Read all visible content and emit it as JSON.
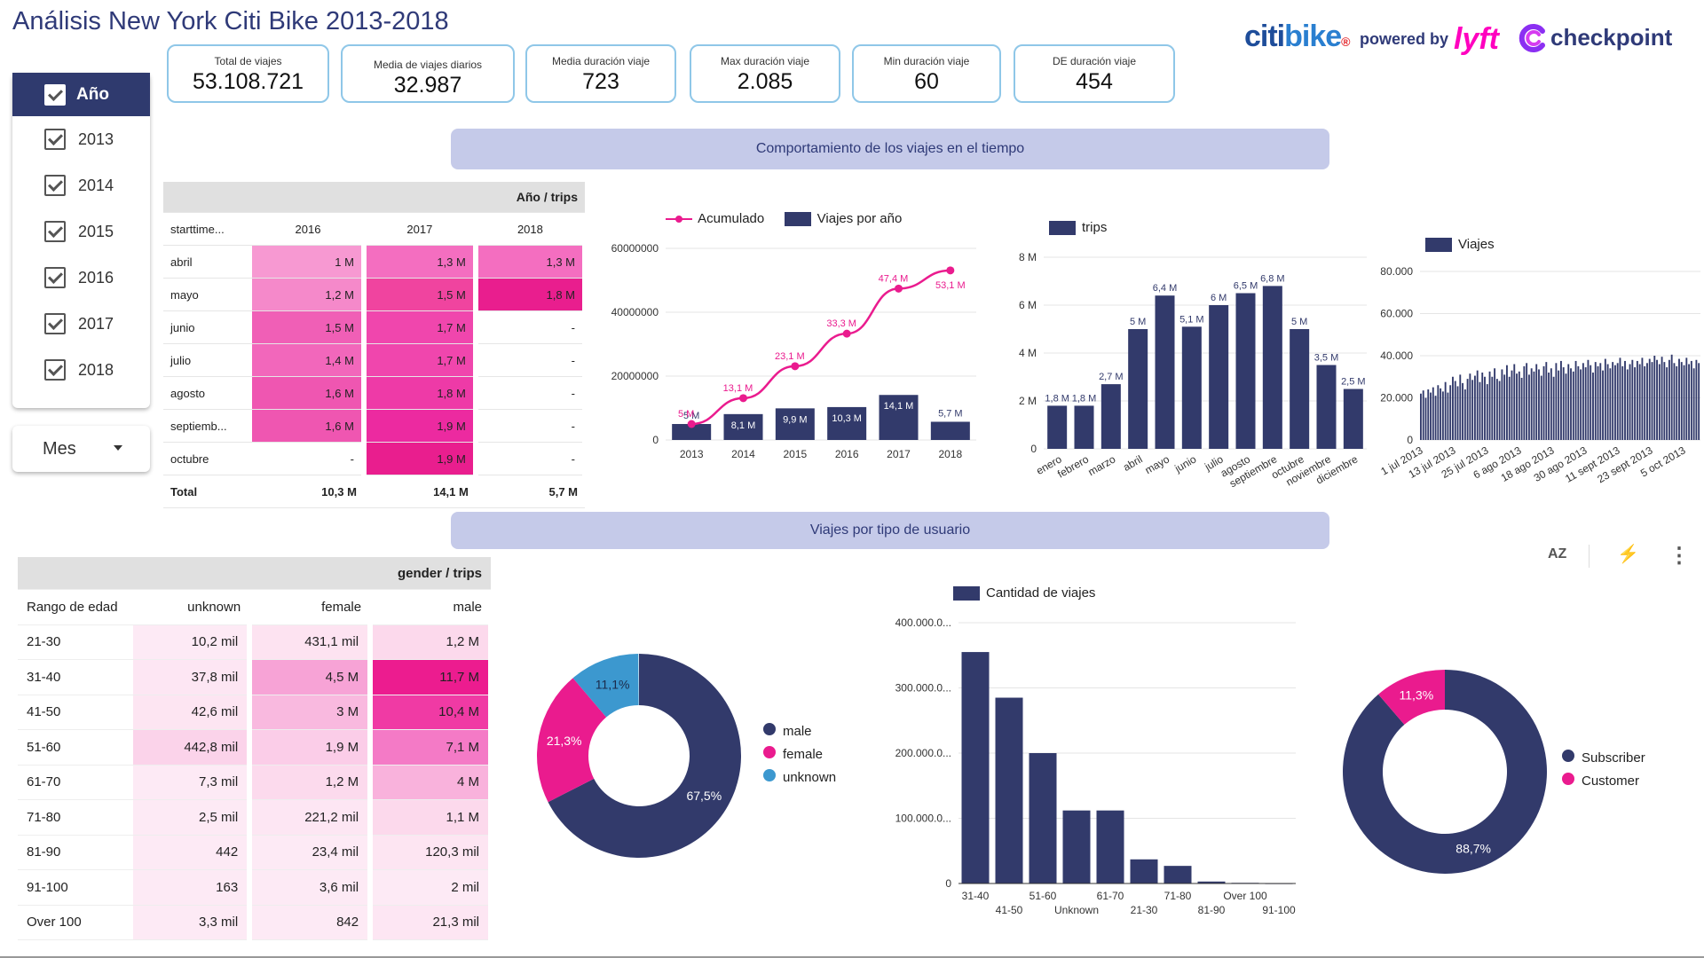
{
  "title": "Análisis New York Citi Bike 2013-2018",
  "logos": {
    "citi": "citi",
    "bike": "bike",
    "r": "®",
    "powered": "powered by",
    "lyft": "lyft",
    "checkpoint": "checkpoint"
  },
  "kpis": [
    {
      "label": "Total de viajes",
      "value": "53.108.721"
    },
    {
      "label": "Media de viajes diarios",
      "value": "32.987"
    },
    {
      "label": "Media duración viaje",
      "value": "723"
    },
    {
      "label": "Max duración viaje",
      "value": "2.085"
    },
    {
      "label": "Min duración viaje",
      "value": "60"
    },
    {
      "label": "DE duración viaje",
      "value": "454"
    }
  ],
  "filter": {
    "header": "Año",
    "items": [
      "2013",
      "2014",
      "2015",
      "2016",
      "2017",
      "2018"
    ],
    "mes": "Mes"
  },
  "banners": {
    "tiempo": "Comportamiento de los viajes en el tiempo",
    "usuario": "Viajes por tipo de usuario"
  },
  "table_year": {
    "group": "Año / trips",
    "cols": [
      "starttime...",
      "2016",
      "2017",
      "2018"
    ],
    "rows": [
      {
        "m": "abril",
        "v": [
          "1 M",
          "1,3 M",
          "1,3 M"
        ]
      },
      {
        "m": "mayo",
        "v": [
          "1,2 M",
          "1,5 M",
          "1,8 M"
        ]
      },
      {
        "m": "junio",
        "v": [
          "1,5 M",
          "1,7 M",
          "-"
        ]
      },
      {
        "m": "julio",
        "v": [
          "1,4 M",
          "1,7 M",
          "-"
        ]
      },
      {
        "m": "agosto",
        "v": [
          "1,6 M",
          "1,8 M",
          "-"
        ]
      },
      {
        "m": "septiemb...",
        "v": [
          "1,6 M",
          "1,9 M",
          "-"
        ]
      },
      {
        "m": "octubre",
        "v": [
          "-",
          "1,9 M",
          "-"
        ]
      }
    ],
    "total": {
      "label": "Total",
      "v": [
        "10,3 M",
        "14,1 M",
        "5,7 M"
      ]
    },
    "colors": [
      [
        "#f799d2",
        "#f46ec0",
        "#f46ec0"
      ],
      [
        "#f589ca",
        "#f0449f",
        "#e91e8e"
      ],
      [
        "#f05fb6",
        "#f046ad",
        "#ffffff"
      ],
      [
        "#f267bb",
        "#f046ad",
        "#ffffff"
      ],
      [
        "#ef56b1",
        "#ee3aa7",
        "#ffffff"
      ],
      [
        "#ef56b1",
        "#ec2aa0",
        "#ffffff"
      ],
      [
        "#ffffff",
        "#e91e8e",
        "#ffffff"
      ]
    ]
  },
  "chart_combo": {
    "type": "bar",
    "legend": [
      "Acumulado",
      "Viajes por año"
    ],
    "categories": [
      "2013",
      "2014",
      "2015",
      "2016",
      "2017",
      "2018"
    ],
    "bars": [
      5.0,
      8.1,
      9.9,
      10.3,
      14.1,
      5.7
    ],
    "bar_labels": [
      "5 M",
      "8,1 M",
      "9,9 M",
      "10,3 M",
      "14,1 M",
      "5,7 M"
    ],
    "line": [
      5.0,
      13.1,
      23.1,
      33.3,
      47.4,
      53.1
    ],
    "line_labels": [
      "5 M",
      "13,1 M",
      "23,1 M",
      "33,3 M",
      "47,4 M",
      "53,1 M"
    ],
    "yticks": [
      "0",
      "20000000",
      "40000000",
      "60000000"
    ],
    "ylim": [
      0,
      60
    ]
  },
  "chart_month": {
    "type": "bar",
    "legend": "trips",
    "categories": [
      "enero",
      "febrero",
      "marzo",
      "abril",
      "mayo",
      "junio",
      "julio",
      "agosto",
      "septiembre",
      "octubre",
      "noviembre",
      "diciembre"
    ],
    "values": [
      1.8,
      1.8,
      2.7,
      5.0,
      6.4,
      5.1,
      6.0,
      6.5,
      6.8,
      5.0,
      3.5,
      2.5
    ],
    "labels": [
      "1,8 M",
      "1,8 M",
      "2,7 M",
      "5 M",
      "6,4 M",
      "5,1 M",
      "6 M",
      "6,5 M",
      "6,8 M",
      "5 M",
      "3,5 M",
      "2,5 M"
    ],
    "yticks": [
      "0",
      "2 M",
      "4 M",
      "6 M",
      "8 M"
    ],
    "ylim": [
      0,
      8
    ]
  },
  "chart_daily": {
    "type": "bar",
    "legend": "Viajes",
    "xticks": [
      "1 jul 2013",
      "13 jul 2013",
      "25 jul 2013",
      "6 ago 2013",
      "18 ago 2013",
      "30 ago 2013",
      "11 sept 2013",
      "23 sept 2013",
      "5 oct 2013"
    ],
    "yticks": [
      "0",
      "20.000",
      "40.000",
      "60.000",
      "80.000"
    ],
    "ylim": [
      0,
      80000
    ],
    "values": [
      22000,
      23500,
      20000,
      24000,
      22500,
      25000,
      21000,
      26000,
      24500,
      23000,
      27500,
      22500,
      26000,
      30000,
      28000,
      25500,
      31000,
      27000,
      24000,
      29000,
      31500,
      28500,
      30500,
      33000,
      27500,
      32000,
      30000,
      26500,
      32500,
      30000,
      34000,
      29000,
      28000,
      33500,
      31000,
      35500,
      30000,
      33000,
      36000,
      31500,
      32500,
      29500,
      35000,
      36500,
      31000,
      34000,
      32500,
      36000,
      33500,
      30500,
      35000,
      37000,
      32000,
      34000,
      30000,
      36500,
      33000,
      37500,
      34500,
      31500,
      36000,
      34000,
      32500,
      37500,
      35000,
      33500,
      36500,
      34500,
      38000,
      35500,
      32000,
      37000,
      35000,
      36500,
      33000,
      38500,
      36000,
      34000,
      37000,
      35500,
      36500,
      39000,
      35000,
      37500,
      33500,
      36000,
      38000,
      34500,
      37500,
      36000,
      39000,
      35000,
      36500,
      38500,
      37000,
      40000,
      38000,
      36000,
      39500,
      37000,
      34500,
      38000,
      40500,
      36500,
      35000,
      38500,
      37000,
      35500,
      39000,
      36000,
      37500,
      34000,
      38000,
      36500
    ]
  },
  "toolbar": {
    "sort": "AZ",
    "bolt": "⚡",
    "more": "⋮"
  },
  "table_gender": {
    "group": "gender / trips",
    "cols": [
      "Rango de edad",
      "unknown",
      "female",
      "male"
    ],
    "rows": [
      {
        "r": "21-30",
        "v": [
          "10,2 mil",
          "431,1 mil",
          "1,2 M"
        ]
      },
      {
        "r": "31-40",
        "v": [
          "37,8 mil",
          "4,5 M",
          "11,7 M"
        ]
      },
      {
        "r": "41-50",
        "v": [
          "42,6 mil",
          "3 M",
          "10,4 M"
        ]
      },
      {
        "r": "51-60",
        "v": [
          "442,8 mil",
          "1,9 M",
          "7,1 M"
        ]
      },
      {
        "r": "61-70",
        "v": [
          "7,3 mil",
          "1,2 M",
          "4 M"
        ]
      },
      {
        "r": "71-80",
        "v": [
          "2,5 mil",
          "221,2 mil",
          "1,1 M"
        ]
      },
      {
        "r": "81-90",
        "v": [
          "442",
          "23,4 mil",
          "120,3 mil"
        ]
      },
      {
        "r": "91-100",
        "v": [
          "163",
          "3,6 mil",
          "2 mil"
        ]
      },
      {
        "r": "Over 100",
        "v": [
          "3,3 mil",
          "842",
          "21,3 mil"
        ]
      }
    ],
    "colors": [
      [
        "#fdeaf5",
        "#fde3f1",
        "#fcd9ec"
      ],
      [
        "#fde6f3",
        "#f7a3d6",
        "#ec1c8f"
      ],
      [
        "#fde5f2",
        "#f9b9df",
        "#f03aa4"
      ],
      [
        "#fbd3ea",
        "#fbcde8",
        "#f47ac6"
      ],
      [
        "#fdeaf5",
        "#fcdaed",
        "#f9b2dc"
      ],
      [
        "#fdeaf5",
        "#fde6f3",
        "#fcd9ec"
      ],
      [
        "#fdeaf5",
        "#fdeaf5",
        "#fde5f2"
      ],
      [
        "#fdeaf5",
        "#fdeaf5",
        "#fdeaf5"
      ],
      [
        "#fdeaf5",
        "#fdeaf5",
        "#fde6f3"
      ]
    ]
  },
  "chart_gender": {
    "type": "pie",
    "labels": [
      "male",
      "female",
      "unknown"
    ],
    "values": [
      67.5,
      21.3,
      11.1
    ],
    "value_labels": [
      "67,5%",
      "21,3%",
      "11,1%"
    ],
    "colors": [
      "#323a6b",
      "#ea1b8e",
      "#3c98cf"
    ]
  },
  "chart_age": {
    "type": "bar",
    "legend": "Cantidad de viajes",
    "categories": [
      "31-40",
      "41-50",
      "51-60",
      "Unknown",
      "61-70",
      "21-30",
      "71-80",
      "81-90",
      "Over 100",
      "91-100"
    ],
    "values": [
      355000,
      285000,
      200000,
      112000,
      112000,
      37000,
      27000,
      3000,
      1000,
      500
    ],
    "yticks": [
      "0",
      "100.000.0...",
      "200.000.0...",
      "300.000.0...",
      "400.000.0..."
    ],
    "ylim": [
      0,
      400000
    ]
  },
  "chart_usertype": {
    "type": "pie",
    "labels": [
      "Subscriber",
      "Customer"
    ],
    "values": [
      88.7,
      11.3
    ],
    "value_labels": [
      "88,7%",
      "11,3%"
    ],
    "colors": [
      "#323a6b",
      "#ea1b8e"
    ]
  },
  "colors": {
    "navy": "#323a6b",
    "pink": "#ea1b8e",
    "blue": "#3c98cf",
    "banner": "#c5cae9",
    "kpi_border": "#8fc7e8"
  }
}
